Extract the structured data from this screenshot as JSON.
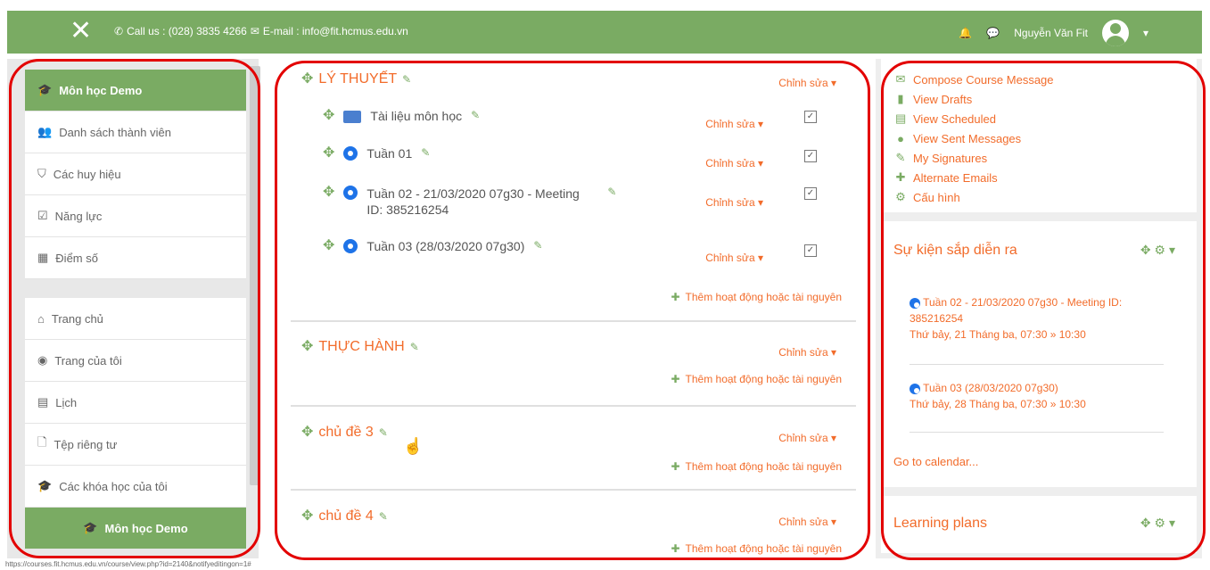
{
  "topbar": {
    "close_icon": "✕",
    "call_label": "Call us : (028) 3835 4266",
    "email_label": "E-mail : info@fit.hcmus.edu.vn",
    "user_name": "Nguyễn Văn Fit"
  },
  "leftnav": {
    "group1": [
      {
        "icon": "graduation-cap-icon",
        "label": "Môn học Demo",
        "active": true
      },
      {
        "icon": "users-icon",
        "label": "Danh sách thành viên"
      },
      {
        "icon": "shield-icon",
        "label": "Các huy hiệu"
      },
      {
        "icon": "checkbox-icon",
        "label": "Năng lực"
      },
      {
        "icon": "table-icon",
        "label": "Điểm số"
      }
    ],
    "group2": [
      {
        "icon": "home-icon",
        "label": "Trang chủ"
      },
      {
        "icon": "dashboard-icon",
        "label": "Trang của tôi"
      },
      {
        "icon": "calendar-icon",
        "label": "Lịch"
      },
      {
        "icon": "file-icon",
        "label": "Tệp riêng tư"
      },
      {
        "icon": "graduation-cap-icon",
        "label": "Các khóa học của tôi"
      },
      {
        "icon": "graduation-cap-icon",
        "label": "Môn học Demo",
        "active": true
      }
    ]
  },
  "course": {
    "edit_label": "Chỉnh sửa ▾",
    "add_label": "Thêm hoạt động hoặc tài nguyên",
    "sections": [
      {
        "title": "LÝ THUYẾT",
        "activities": [
          "Tài liệu môn học",
          "Tuần 01",
          "Tuần 02 - 21/03/2020 07g30 - Meeting ID: 385216254",
          "Tuần 03 (28/03/2020 07g30)"
        ]
      },
      {
        "title": "THỰC HÀNH"
      },
      {
        "title": "chủ đề 3"
      },
      {
        "title": "chủ đề 4"
      }
    ]
  },
  "right": {
    "messages": [
      "Compose Course Message",
      "View Drafts",
      "View Scheduled",
      "View Sent Messages",
      "My Signatures",
      "Alternate Emails",
      "Cấu hình"
    ],
    "events_title": "Sự kiện sắp diễn ra",
    "events": [
      {
        "title": "Tuần 02 - 21/03/2020 07g30 - Meeting ID: 385216254",
        "time": "Thứ bảy, 21 Tháng ba, 07:30 » 10:30"
      },
      {
        "title": "Tuần 03 (28/03/2020 07g30)",
        "time": "Thứ bảy, 28 Tháng ba, 07:30 » 10:30"
      }
    ],
    "calendar_link": "Go to calendar...",
    "learning_title": "Learning plans"
  },
  "status_url": "https://courses.fit.hcmus.edu.vn/course/view.php?id=2140&notifyeditingon=1#"
}
